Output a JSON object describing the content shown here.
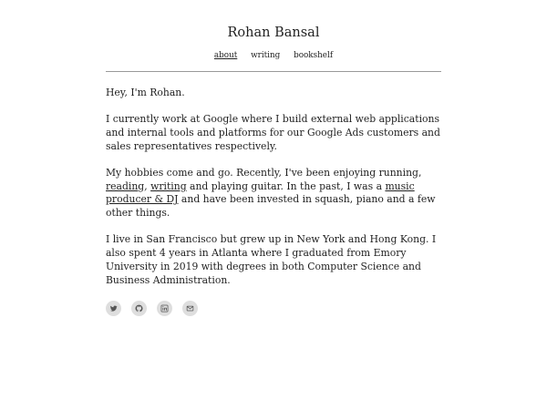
{
  "header": {
    "site_title": "Rohan Bansal",
    "nav": [
      {
        "label": "about",
        "active": true
      },
      {
        "label": "writing",
        "active": false
      },
      {
        "label": "bookshelf",
        "active": false
      }
    ]
  },
  "content": {
    "greeting": "Hey, I'm Rohan.",
    "work": "I currently work at Google where I build external web applications and internal tools and platforms for our Google Ads customers and sales representatives respectively.",
    "hobbies": {
      "text_1": "My hobbies come and go. Recently, I've been enjoying running, ",
      "link_reading": "reading",
      "text_2": ", ",
      "link_writing": "writing",
      "text_3": " and playing guitar. In the past, I was a ",
      "link_music": "music producer & DJ",
      "text_4": " and have been invested in squash, piano and a few other things."
    },
    "location": "I live in San Francisco but grew up in New York and Hong Kong. I also spent 4 years in Atlanta where I graduated from Emory University in 2019 with degrees in both Computer Science and Business Administration."
  },
  "socials": [
    {
      "icon": "twitter-icon"
    },
    {
      "icon": "github-icon"
    },
    {
      "icon": "linkedin-icon"
    },
    {
      "icon": "email-icon"
    }
  ],
  "colors": {
    "text": "#1f1f1f",
    "rule": "#9a9a9a",
    "icon_bg": "#dedede",
    "icon_fg": "#555555"
  }
}
